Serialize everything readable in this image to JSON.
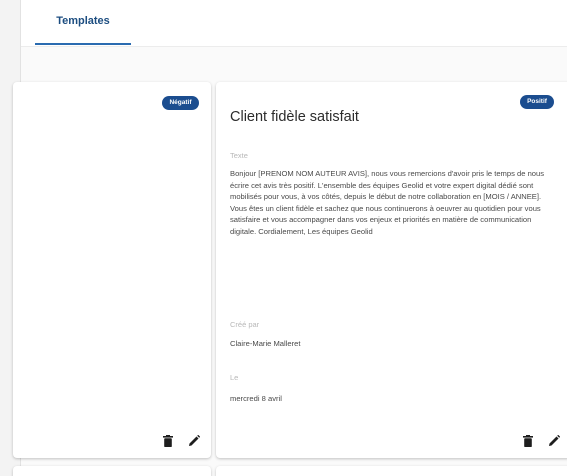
{
  "tabs": [
    {
      "label": "Templates",
      "active": true
    }
  ],
  "cards": [
    {
      "badge": "Négatif",
      "badge_color": "#1b4d8f"
    },
    {
      "title": "Client fidèle satisfait",
      "badge": "Positif",
      "badge_color": "#1b4d8f",
      "text_label": "Texte",
      "text_value": "Bonjour [PRENOM NOM AUTEUR AVIS], nous vous remercions d'avoir pris le temps de nous écrire cet avis très positif. L'ensemble des équipes Geolid et votre expert digital dédié sont mobilisés pour vous, à vos côtés, depuis le début de notre collaboration en [MOIS / ANNEE]. Vous êtes un client fidèle et sachez que nous continuerons à oeuvrer au quotidien pour vous satisfaire et vous accompagner dans vos enjeux et priorités en matière de communication digitale. Cordialement, Les équipes Geolid",
      "author_label": "Créé par",
      "author_value": "Claire-Marie Malleret",
      "date_label": "Le",
      "date_value": "mercredi 8 avril"
    }
  ],
  "icons": {
    "delete": "trash-icon",
    "edit": "pencil-icon"
  }
}
